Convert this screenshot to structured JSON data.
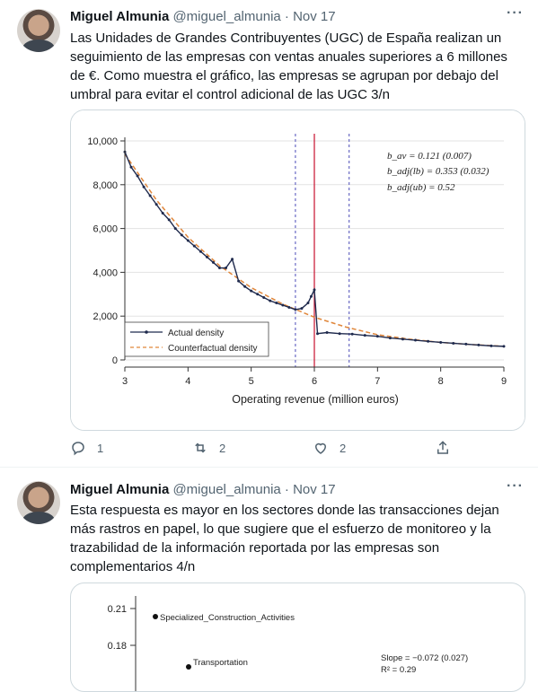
{
  "tweets": [
    {
      "author": "Miguel Almunia",
      "handle": "@miguel_almunia",
      "separator": "·",
      "date": "Nov 17",
      "more": "···",
      "text": "Las Unidades de Grandes Contribuyentes (UGC) de España realizan un seguimiento de las empresas con ventas anuales superiores a 6 millones de €. Como muestra el gráfico, las empresas se agrupan por debajo del umbral para evitar el control adicional de las UGC 3/n",
      "actions": {
        "reply_count": "1",
        "retweet_count": "2",
        "like_count": "2"
      }
    },
    {
      "author": "Miguel Almunia",
      "handle": "@miguel_almunia",
      "separator": "·",
      "date": "Nov 17",
      "more": "···",
      "text": "Esta respuesta es mayor en los sectores donde las transacciones dejan más rastros en papel, lo que sugiere que el esfuerzo de monitoreo y la trazabilidad de la información reportada por las empresas son complementarios 4/n"
    }
  ],
  "chart_data": [
    {
      "type": "line",
      "xlabel": "Operating revenue (million euros)",
      "ylabel": "",
      "xlim": [
        3,
        9
      ],
      "ylim": [
        0,
        10000
      ],
      "x_ticks": [
        "3",
        "4",
        "5",
        "6",
        "7",
        "8",
        "9"
      ],
      "y_ticks": [
        "0",
        "2,000",
        "4,000",
        "6,000",
        "8,000",
        "10,000"
      ],
      "grid": true,
      "legend_position": "bottom-left",
      "vertical_lines": [
        {
          "x": 5.7,
          "style": "dashed",
          "color": "#6a6ac4"
        },
        {
          "x": 6.0,
          "style": "solid",
          "color": "#c8102e"
        },
        {
          "x": 6.55,
          "style": "dashed",
          "color": "#6a6ac4"
        }
      ],
      "annotations": [
        "b_av = 0.121 (0.007)",
        "b_adj(lb) = 0.353 (0.032)",
        "b_adj(ub) = 0.52"
      ],
      "series": [
        {
          "name": "Actual density",
          "color": "#1f2a4d",
          "x": [
            3.0,
            3.1,
            3.2,
            3.3,
            3.4,
            3.5,
            3.6,
            3.7,
            3.8,
            3.9,
            4.0,
            4.1,
            4.2,
            4.3,
            4.4,
            4.5,
            4.6,
            4.7,
            4.8,
            4.9,
            5.0,
            5.1,
            5.2,
            5.3,
            5.4,
            5.5,
            5.6,
            5.7,
            5.8,
            5.9,
            5.95,
            6.0,
            6.05,
            6.2,
            6.4,
            6.6,
            6.8,
            7.0,
            7.2,
            7.4,
            7.6,
            7.8,
            8.0,
            8.2,
            8.4,
            8.6,
            8.8,
            9.0
          ],
          "values": [
            9500,
            8800,
            8400,
            7900,
            7500,
            7100,
            6700,
            6400,
            6000,
            5700,
            5450,
            5200,
            4950,
            4700,
            4450,
            4200,
            4200,
            4600,
            3600,
            3350,
            3150,
            3000,
            2850,
            2700,
            2600,
            2500,
            2400,
            2300,
            2350,
            2600,
            2900,
            3200,
            1200,
            1250,
            1200,
            1180,
            1120,
            1080,
            1000,
            950,
            900,
            850,
            800,
            760,
            720,
            680,
            640,
            620
          ]
        },
        {
          "name": "Counterfactual density",
          "color": "#e0863a",
          "x": [
            3.0,
            3.5,
            4.0,
            4.5,
            5.0,
            5.5,
            6.0,
            6.5,
            7.0,
            7.5,
            8.0,
            8.5,
            9.0
          ],
          "values": [
            9400,
            7300,
            5600,
            4300,
            3300,
            2550,
            1950,
            1500,
            1150,
            950,
            800,
            700,
            620
          ]
        }
      ]
    },
    {
      "type": "scatter",
      "y_ticks": [
        "0.18",
        "0.21"
      ],
      "points": [
        {
          "label": "Specialized_Construction_Activities",
          "y": 0.205
        },
        {
          "label": "Transportation",
          "y": 0.17
        }
      ],
      "annotations": [
        "Slope = −0.072 (0.027)",
        "R² = 0.29"
      ]
    }
  ]
}
